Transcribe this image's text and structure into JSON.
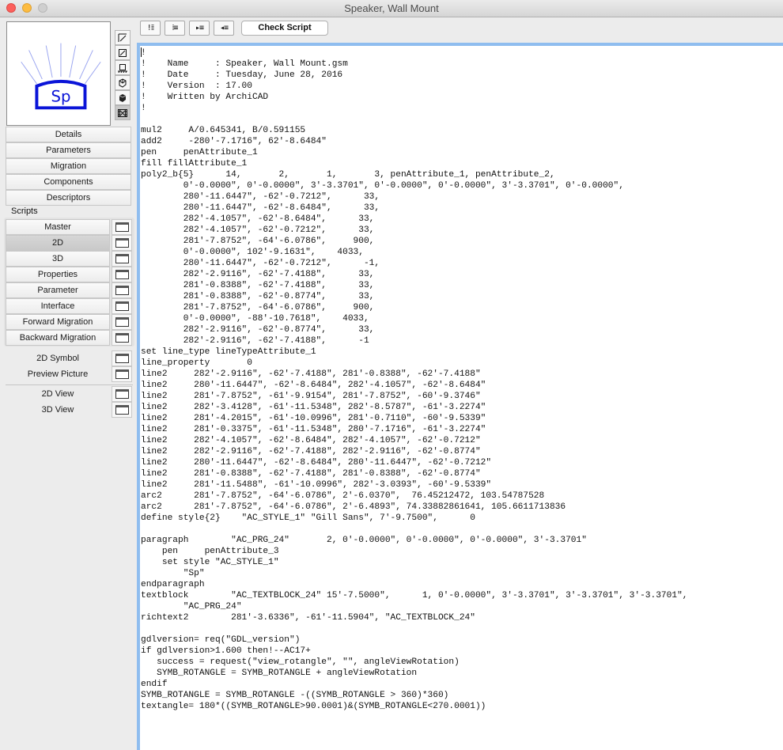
{
  "window": {
    "title": "Speaker, Wall Mount"
  },
  "preview": {
    "label": "Sp",
    "colors": {
      "rays": "#9aa5f0",
      "box": "#0a14d8",
      "text": "#0a14d8"
    }
  },
  "view_buttons": [
    {
      "name": "plan-view-icon",
      "glyph": "floor-plan"
    },
    {
      "name": "2d-view-icon",
      "glyph": "square-slash"
    },
    {
      "name": "elevation-icon",
      "glyph": "elevation"
    },
    {
      "name": "3d-wire-icon",
      "glyph": "cube-wire"
    },
    {
      "name": "3d-solid-icon",
      "glyph": "cube-solid"
    },
    {
      "name": "preview-film-icon",
      "glyph": "film"
    }
  ],
  "nav": {
    "items": [
      "Details",
      "Parameters",
      "Migration",
      "Components",
      "Descriptors"
    ]
  },
  "scripts": {
    "label": "Scripts",
    "items": [
      "Master",
      "2D",
      "3D",
      "Properties",
      "Parameter",
      "Interface",
      "Forward Migration",
      "Backward Migration"
    ],
    "selected": "2D"
  },
  "extras": {
    "group1": [
      "2D Symbol",
      "Preview Picture"
    ],
    "group2": [
      "2D View",
      "3D View"
    ]
  },
  "toolbar": {
    "buttons": [
      {
        "name": "comment-button",
        "glyph": "!⁞⁞"
      },
      {
        "name": "uncomment-button",
        "glyph": "⁞≡"
      },
      {
        "name": "indent-button",
        "glyph": "▸≡"
      },
      {
        "name": "outdent-button",
        "glyph": "◂≡"
      }
    ],
    "check_script": "Check Script"
  },
  "code_lines": [
    "!",
    "!    Name     : Speaker, Wall Mount.gsm",
    "!    Date     : Tuesday, June 28, 2016",
    "!    Version  : 17.00",
    "!    Written by ArchiCAD",
    "!",
    "",
    "mul2     A/0.645341, B/0.591155",
    "add2     -280'-7.1716\", 62'-8.6484\"",
    "pen     penAttribute_1",
    "fill fillAttribute_1",
    "poly2_b{5}      14,       2,       1,       3, penAttribute_1, penAttribute_2,",
    "        0'-0.0000\", 0'-0.0000\", 3'-3.3701\", 0'-0.0000\", 0'-0.0000\", 3'-3.3701\", 0'-0.0000\",",
    "        280'-11.6447\", -62'-0.7212\",      33,",
    "        280'-11.6447\", -62'-8.6484\",      33,",
    "        282'-4.1057\", -62'-8.6484\",      33,",
    "        282'-4.1057\", -62'-0.7212\",      33,",
    "        281'-7.8752\", -64'-6.0786\",     900,",
    "        0'-0.0000\", 102'-9.1631\",    4033,",
    "        280'-11.6447\", -62'-0.7212\",      -1,",
    "        282'-2.9116\", -62'-7.4188\",      33,",
    "        281'-0.8388\", -62'-7.4188\",      33,",
    "        281'-0.8388\", -62'-0.8774\",      33,",
    "        281'-7.8752\", -64'-6.0786\",     900,",
    "        0'-0.0000\", -88'-10.7618\",    4033,",
    "        282'-2.9116\", -62'-0.8774\",      33,",
    "        282'-2.9116\", -62'-7.4188\",      -1",
    "set line_type lineTypeAttribute_1",
    "line_property       0",
    "line2     282'-2.9116\", -62'-7.4188\", 281'-0.8388\", -62'-7.4188\"",
    "line2     280'-11.6447\", -62'-8.6484\", 282'-4.1057\", -62'-8.6484\"",
    "line2     281'-7.8752\", -61'-9.9154\", 281'-7.8752\", -60'-9.3746\"",
    "line2     282'-3.4128\", -61'-11.5348\", 282'-8.5787\", -61'-3.2274\"",
    "line2     281'-4.2015\", -61'-10.0996\", 281'-0.7110\", -60'-9.5339\"",
    "line2     281'-0.3375\", -61'-11.5348\", 280'-7.1716\", -61'-3.2274\"",
    "line2     282'-4.1057\", -62'-8.6484\", 282'-4.1057\", -62'-0.7212\"",
    "line2     282'-2.9116\", -62'-7.4188\", 282'-2.9116\", -62'-0.8774\"",
    "line2     280'-11.6447\", -62'-8.6484\", 280'-11.6447\", -62'-0.7212\"",
    "line2     281'-0.8388\", -62'-7.4188\", 281'-0.8388\", -62'-0.8774\"",
    "line2     281'-11.5488\", -61'-10.0996\", 282'-3.0393\", -60'-9.5339\"",
    "arc2      281'-7.8752\", -64'-6.0786\", 2'-6.0370\",  76.45212472, 103.54787528",
    "arc2      281'-7.8752\", -64'-6.0786\", 2'-6.4893\", 74.33882861641, 105.6611713836",
    "define style{2}    \"AC_STYLE_1\" \"Gill Sans\", 7'-9.7500\",      0",
    "",
    "paragraph        \"AC_PRG_24\"       2, 0'-0.0000\", 0'-0.0000\", 0'-0.0000\", 3'-3.3701\"",
    "    pen     penAttribute_3",
    "    set style \"AC_STYLE_1\"",
    "        \"Sp\"",
    "endparagraph",
    "textblock        \"AC_TEXTBLOCK_24\" 15'-7.5000\",      1, 0'-0.0000\", 3'-3.3701\", 3'-3.3701\", 3'-3.3701\",",
    "        \"AC_PRG_24\"",
    "richtext2        281'-3.6336\", -61'-11.5904\", \"AC_TEXTBLOCK_24\"",
    "",
    "gdlversion= req(\"GDL_version\")",
    "if gdlversion>1.600 then!--AC17+",
    "   success = request(\"view_rotangle\", \"\", angleViewRotation)",
    "   SYMB_ROTANGLE = SYMB_ROTANGLE + angleViewRotation",
    "endif",
    "SYMB_ROTANGLE = SYMB_ROTANGLE -((SYMB_ROTANGLE > 360)*360)",
    "textangle= 180*((SYMB_ROTANGLE>90.0001)&(SYMB_ROTANGLE<270.0001))"
  ]
}
